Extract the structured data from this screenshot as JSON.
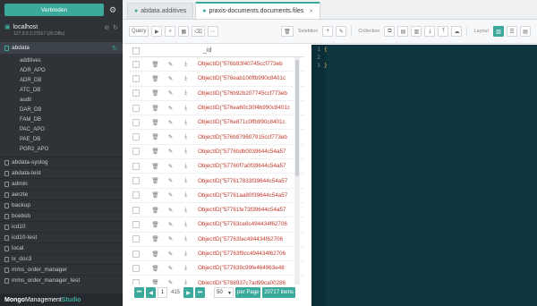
{
  "sidebar": {
    "connect_label": "Verbinden",
    "host": {
      "name": "localhost",
      "sub": "127.0.0.1:27017 (26 DBs)"
    },
    "active_db": "abdata",
    "collections": [
      "additives",
      "ADR_APO",
      "ADR_DB",
      "ATC_DB",
      "audit",
      "DAR_DB",
      "FAM_DB",
      "PAC_APO",
      "PAE_DB",
      "PGR2_APO"
    ],
    "databases": [
      "abdata-syslog",
      "abdata-test",
      "admin",
      "aerzte",
      "backup",
      "bcebsb",
      "icd10",
      "icd10-test",
      "local",
      "lx_doc3",
      "mms_order_manager",
      "mms_order_manager_test"
    ],
    "brand": {
      "part1": "Mongo",
      "part2": "Management",
      "part3": "Studio"
    }
  },
  "tabs": [
    {
      "label": "abdata.additives",
      "active": false
    },
    {
      "label": "praxis-documents.documents.files",
      "active": true
    }
  ],
  "toolbar": {
    "query_label": "Query",
    "selection_label": "Selektion",
    "collection_label": "Collection",
    "layout_label": "Layout"
  },
  "grid": {
    "column_header": "_id",
    "rows": [
      "ObjectID(\"576b93f40745ccf773eb",
      "ObjectID(\"576eab100ffb990c8401c",
      "ObjectID(\"576b92b207745ccf773eb",
      "ObjectID(\"576ea60c30f4b990c8401c",
      "ObjectID(\"576e871c0ffb990c8401c",
      "ObjectID(\"576b979607915ccf773eb",
      "ObjectID(\"57760db0039644c54a57",
      "ObjectID(\"57760f7a0f39644c54a57",
      "ObjectID(\"577617833f39644c54a57",
      "ObjectID(\"57761aa80f39644c54a57",
      "ObjectID(\"57761fe73f39644c54a57",
      "ObjectID(\"57763ce8c494434f62706",
      "ObjectID(\"57763fac494434f62706",
      "ObjectID(\"57763f9cc494434f62706",
      "ObjectID(\"577639c99fe464963e48",
      "ObjectID(\"5788937c7ad99ca00286"
    ]
  },
  "pager": {
    "current_page": "1",
    "total_pages": "415",
    "per_page": "50",
    "per_page_label": "per Page",
    "total_items": "20717 items"
  },
  "editor": {
    "lines": [
      "{",
      "",
      "}"
    ]
  }
}
